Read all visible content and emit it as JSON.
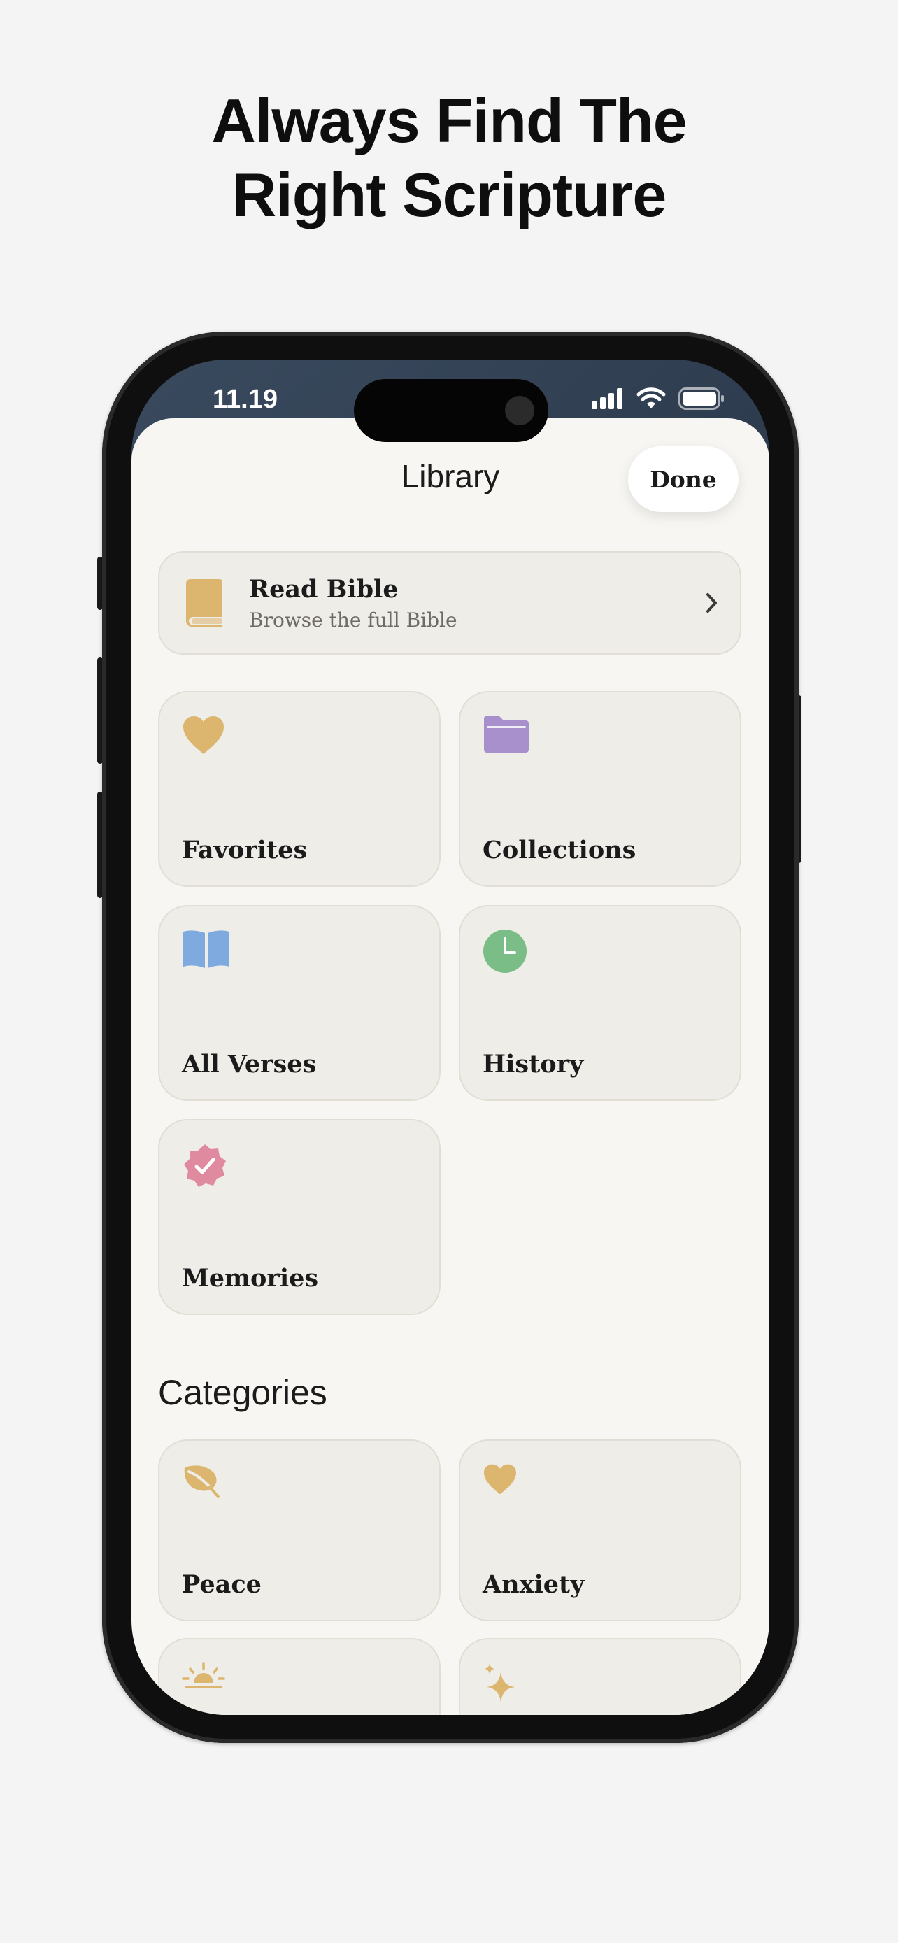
{
  "headline": {
    "line1": "Always Find The",
    "line2": "Right Scripture"
  },
  "status_bar": {
    "time": "11.19"
  },
  "library": {
    "title": "Library",
    "done_label": "Done",
    "read_bible": {
      "title": "Read Bible",
      "subtitle": "Browse the full Bible"
    },
    "tiles": [
      {
        "label": "Favorites",
        "icon": "heart-icon",
        "color": "#dcb56e"
      },
      {
        "label": "Collections",
        "icon": "folder-icon",
        "color": "#a890cc"
      },
      {
        "label": "All Verses",
        "icon": "open-book-icon",
        "color": "#7eaae0"
      },
      {
        "label": "History",
        "icon": "clock-icon",
        "color": "#7bbd86"
      },
      {
        "label": "Memories",
        "icon": "verified-badge-icon",
        "color": "#e08aa0"
      }
    ]
  },
  "categories": {
    "title": "Categories",
    "items": [
      {
        "label": "Peace",
        "icon": "leaf-icon",
        "color": "#dcb56e"
      },
      {
        "label": "Anxiety",
        "icon": "heart-icon",
        "color": "#dcb56e"
      },
      {
        "label": "",
        "icon": "sunrise-icon",
        "color": "#dcb56e"
      },
      {
        "label": "",
        "icon": "sparkles-icon",
        "color": "#dcb56e"
      }
    ]
  },
  "colors": {
    "accent_gold": "#dcb56e",
    "sheet_bg": "#f8f6f2",
    "card_bg": "#efede8"
  }
}
